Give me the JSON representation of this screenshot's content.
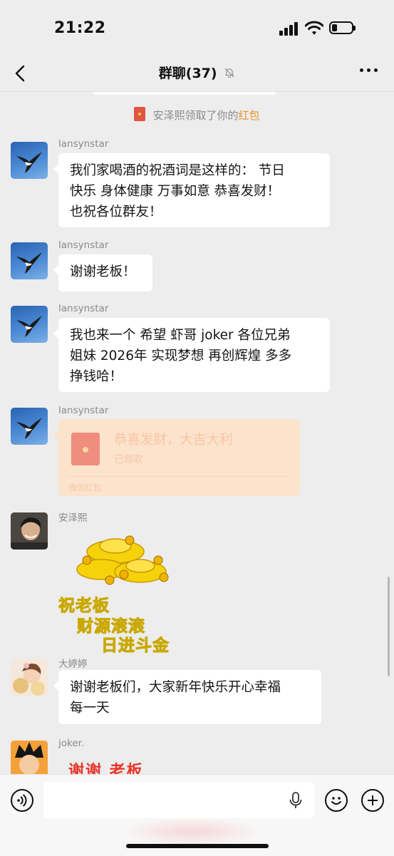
{
  "status": {
    "time": "21:22",
    "battery_percent": 25
  },
  "nav": {
    "back_icon": "chevron-left-icon",
    "title": "群聊(37)",
    "muted_icon": "bell-slash-icon",
    "more_icon": "ellipsis-icon"
  },
  "system_notice": {
    "prefix": "安泽熙领取了你的",
    "highlight": "红包",
    "icon": "red-packet-icon",
    "highlight_color": "#e8922b"
  },
  "messages": [
    {
      "sender": "lansynstar",
      "type": "text",
      "lines": [
        "我们家喝酒的祝酒词是这样的： 节日",
        "快乐 身体健康 万事如意 恭喜发财！",
        "也祝各位群友！"
      ]
    },
    {
      "sender": "lansynstar",
      "type": "text",
      "lines": [
        "谢谢老板！"
      ]
    },
    {
      "sender": "lansynstar",
      "type": "text",
      "lines": [
        "我也来一个 希望 虾哥 joker 各位兄弟",
        "姐妹 2026年 实现梦想 再创辉煌 多多",
        "挣钱哈！"
      ]
    },
    {
      "sender": "lansynstar",
      "type": "red_packet",
      "title": "恭喜发财，大吉大利",
      "status": "已领取",
      "footer": "微信红包"
    },
    {
      "sender": "安泽熙",
      "type": "sticker",
      "sticker_lines": [
        "祝老板",
        "财源滚滚",
        "日进斗金"
      ]
    },
    {
      "sender": "大婷婷",
      "type": "text",
      "lines": [
        "谢谢老板们，大家新年快乐开心幸福",
        "每一天"
      ]
    },
    {
      "sender": "joker.",
      "type": "sticker",
      "sticker_text": "谢谢  老板"
    }
  ],
  "input_bar": {
    "placeholder": "",
    "voice_icon": "voice-icon",
    "mic_icon": "microphone-icon",
    "emoji_icon": "emoji-icon",
    "plus_icon": "plus-icon"
  },
  "colors": {
    "background": "#ededed",
    "red_packet_bg": "#fbe3cc",
    "bubble_bg": "#ffffff"
  }
}
